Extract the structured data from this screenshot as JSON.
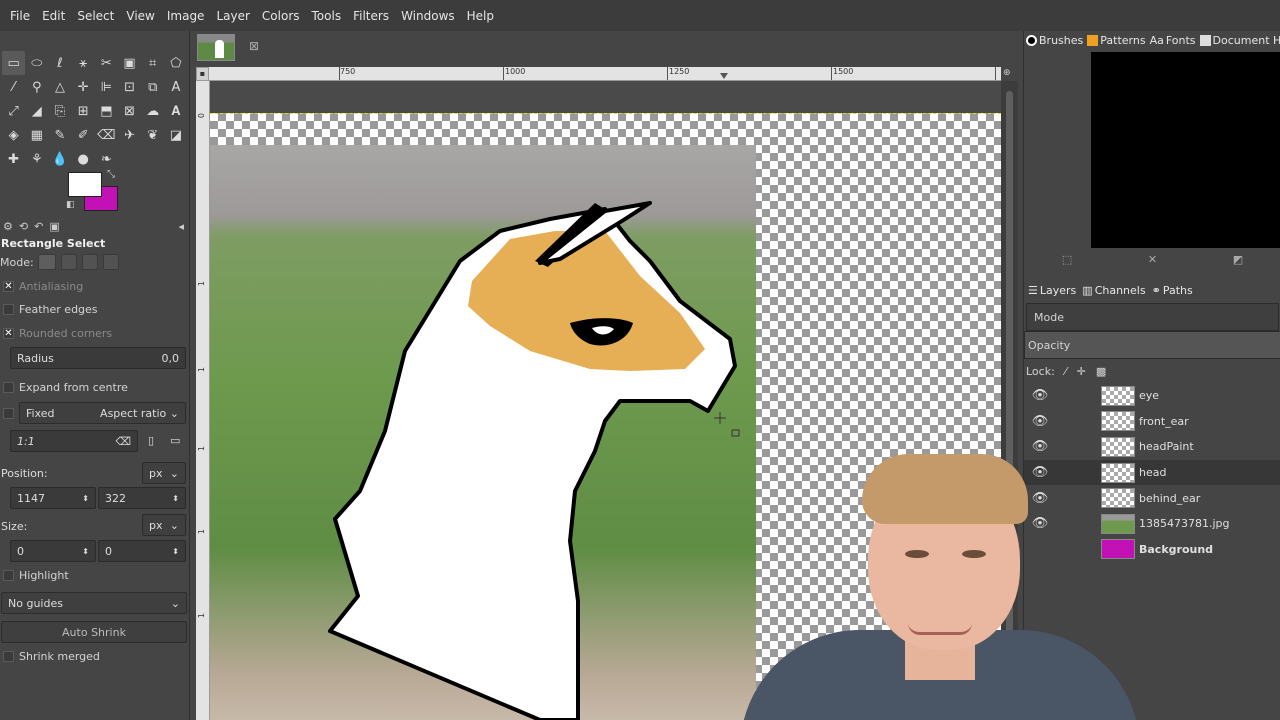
{
  "menubar": {
    "items": [
      "File",
      "Edit",
      "Select",
      "View",
      "Image",
      "Layer",
      "Colors",
      "Tools",
      "Filters",
      "Windows",
      "Help"
    ]
  },
  "toolbox": {
    "tools": [
      "rect-select",
      "ellipse-select",
      "free-select",
      "fuzzy-select",
      "scissors-select",
      "foreground-select",
      "crop",
      "move",
      "bucket",
      "zoom",
      "path",
      "align",
      "unified-transform",
      "cage",
      "text",
      "cage-transform",
      "warp",
      "smudge",
      "clone",
      "handle-transform",
      "flip",
      "perspective",
      "shear",
      "text-tool",
      "bucket-fill",
      "gradient",
      "pencil",
      "paintbrush",
      "eraser",
      "airbrush",
      "ink",
      "mypaint",
      "heal",
      "smudge-2",
      "blur",
      "dodge",
      "color-picker"
    ],
    "fg_color": "#ffffff",
    "bg_color": "#c211b5",
    "tool_title": "Rectangle Select",
    "mode_label": "Mode:",
    "antialiasing": "Antialiasing",
    "feather_edges": "Feather edges",
    "rounded_corners": "Rounded corners",
    "radius_label": "Radius",
    "radius_value": "0,0",
    "expand_from_centre": "Expand from centre",
    "fixed_label": "Fixed",
    "aspect_ratio": "Aspect ratio",
    "ratio_value": "1:1",
    "position_label": "Position:",
    "position_unit": "px",
    "position_x": "1147",
    "position_y": "322",
    "size_label": "Size:",
    "size_unit": "px",
    "size_w": "0",
    "size_h": "0",
    "highlight": "Highlight",
    "guides": "No guides",
    "auto_shrink": "Auto Shrink",
    "shrink_merged": "Shrink merged"
  },
  "ruler": {
    "labels": [
      "750",
      "1000",
      "1250",
      "1500"
    ]
  },
  "vruler": {
    "labels": [
      "0",
      "1",
      "1",
      "1",
      "1",
      "1"
    ]
  },
  "dock": {
    "tabs": [
      "Brushes",
      "Patterns",
      "Fonts",
      "Document Hist"
    ],
    "layer_tabs": [
      "Layers",
      "Channels",
      "Paths"
    ],
    "mode_label": "Mode",
    "opacity_label": "Opacity",
    "lock_label": "Lock:",
    "layers": [
      {
        "name": "eye",
        "thumb": "transparent",
        "selected": false,
        "bold": false
      },
      {
        "name": "front_ear",
        "thumb": "transparent",
        "selected": false,
        "bold": false
      },
      {
        "name": "headPaint",
        "thumb": "transparent",
        "selected": false,
        "bold": false
      },
      {
        "name": "head",
        "thumb": "transparent",
        "selected": true,
        "bold": false
      },
      {
        "name": "behind_ear",
        "thumb": "transparent",
        "selected": false,
        "bold": false
      },
      {
        "name": "1385473781.jpg",
        "thumb": "photo",
        "selected": false,
        "bold": false
      },
      {
        "name": "Background",
        "thumb": "background",
        "selected": false,
        "bold": true
      }
    ]
  },
  "colors": {
    "accent_magenta": "#c211b5",
    "llama_tan": "#e6ae55",
    "selection_dash": "#d8d840"
  }
}
